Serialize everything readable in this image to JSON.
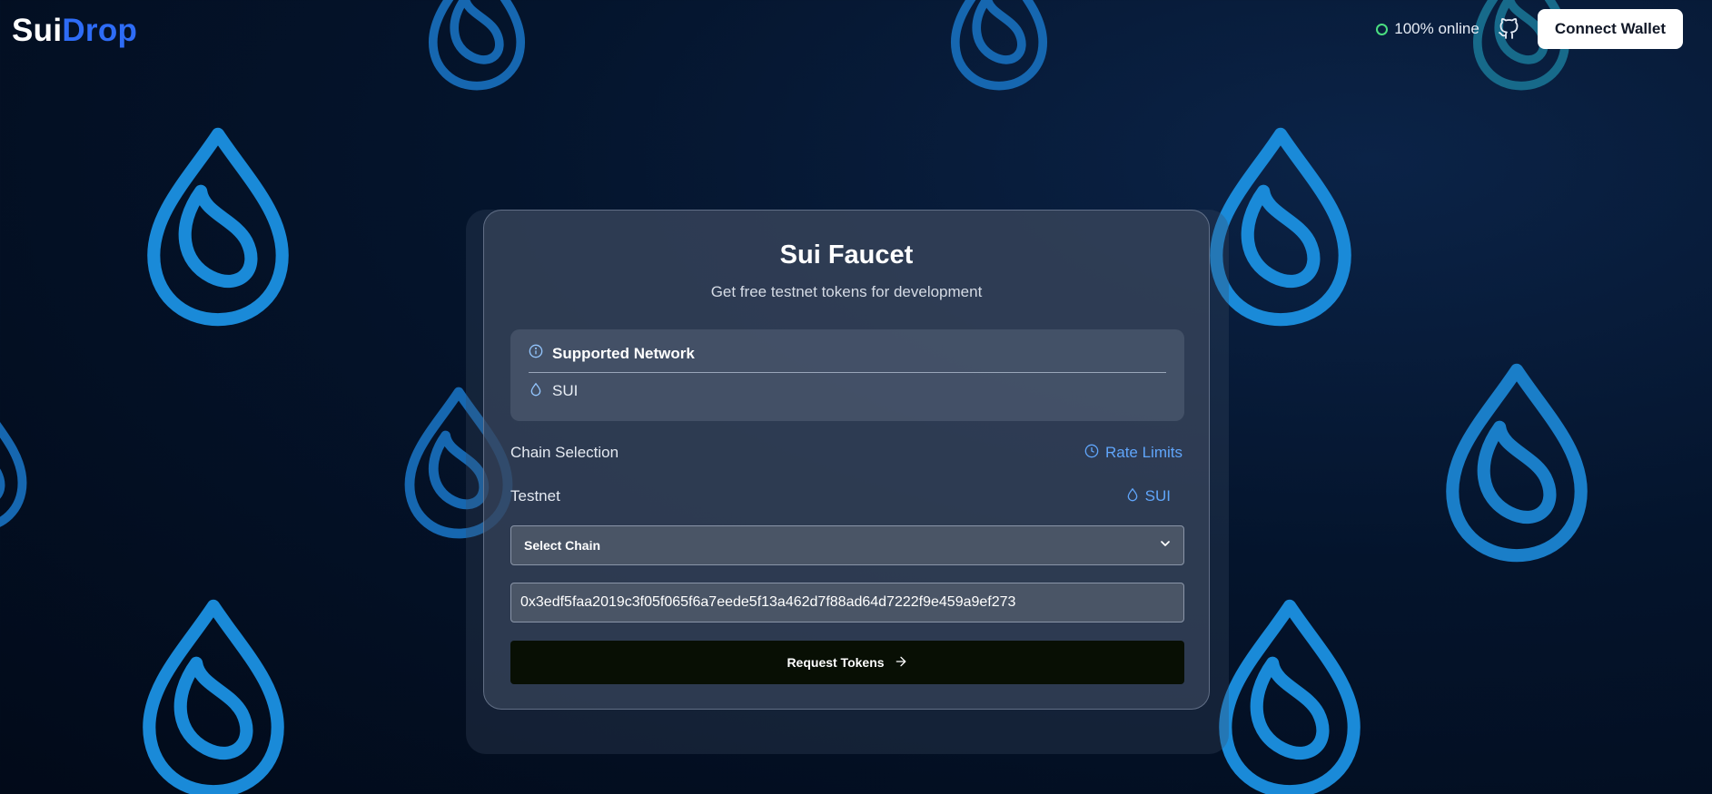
{
  "logo": {
    "part1": "Sui",
    "part2": "Drop"
  },
  "header": {
    "status_text": "100% online",
    "connect_label": "Connect Wallet"
  },
  "card": {
    "title": "Sui Faucet",
    "subtitle": "Get free testnet tokens for development",
    "network": {
      "heading": "Supported Network",
      "items": [
        "SUI"
      ]
    },
    "chain_selection_label": "Chain Selection",
    "rate_limits_label": "Rate Limits",
    "network_label": "Testnet",
    "token_label": "SUI",
    "select": {
      "value": "Select Chain"
    },
    "address_value": "0x3edf5faa2019c3f05f065f6a7eede5f13a462d7f88ad64d7222f9e459a9ef273",
    "request_label": "Request Tokens"
  },
  "colors": {
    "accent": "#2e6cf6",
    "link": "#60a5fa",
    "online": "#4ade80",
    "drop": "#1a8ad8"
  }
}
